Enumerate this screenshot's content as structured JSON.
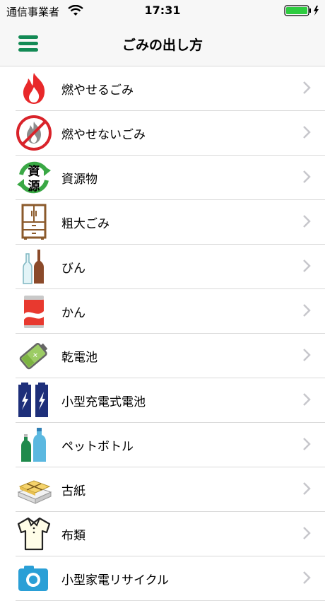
{
  "status_bar": {
    "carrier": "通信事業者",
    "time": "17:31"
  },
  "nav": {
    "title": "ごみの出し方",
    "menu_icon": "hamburger-menu-icon"
  },
  "colors": {
    "accent": "#138a55",
    "chevron": "#c7c7cc",
    "separator": "#d9d9d9"
  },
  "items": [
    {
      "label": "燃やせるごみ",
      "icon": "fire-icon"
    },
    {
      "label": "燃やせないごみ",
      "icon": "no-burn-icon"
    },
    {
      "label": "資源物",
      "icon": "recycle-resources-icon"
    },
    {
      "label": "粗大ごみ",
      "icon": "cabinet-icon"
    },
    {
      "label": "びん",
      "icon": "bottles-icon"
    },
    {
      "label": "かん",
      "icon": "can-icon"
    },
    {
      "label": "乾電池",
      "icon": "battery-icon"
    },
    {
      "label": "小型充電式電池",
      "icon": "rechargeable-battery-icon"
    },
    {
      "label": "ペットボトル",
      "icon": "pet-bottle-icon"
    },
    {
      "label": "古紙",
      "icon": "paper-bundle-icon"
    },
    {
      "label": "布類",
      "icon": "shirt-icon"
    },
    {
      "label": "小型家電リサイクル",
      "icon": "small-appliance-icon"
    }
  ]
}
